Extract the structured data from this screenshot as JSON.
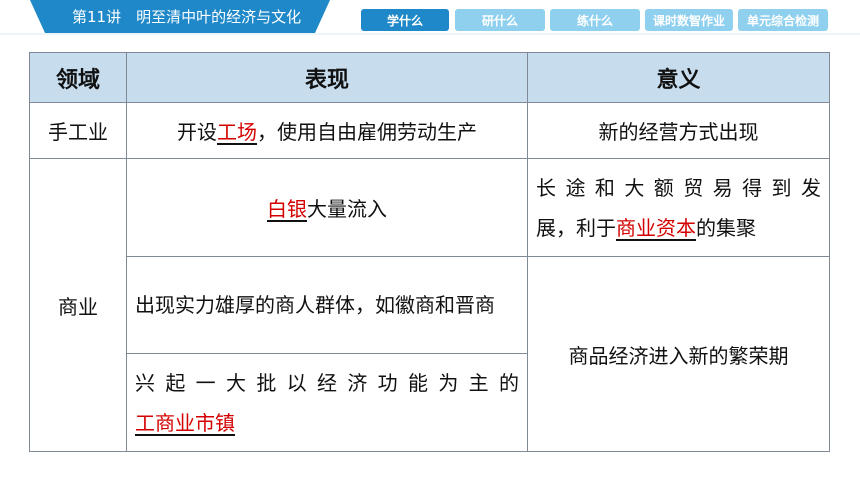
{
  "header": {
    "lesson_title": "第11讲　明至清中叶的经济与文化",
    "tabs": [
      {
        "label": "学什么",
        "active": true
      },
      {
        "label": "研什么",
        "active": false
      },
      {
        "label": "练什么",
        "active": false
      },
      {
        "label": "课时数智作业",
        "active": false
      },
      {
        "label": "单元综合检测",
        "active": false
      }
    ],
    "colors": {
      "accent": "#1e88c9",
      "tab_inactive": "#8fd0ef",
      "table_header": "#c7ddee",
      "highlight": "#d40000"
    }
  },
  "table": {
    "headers": [
      "领域",
      "表现",
      "意义"
    ],
    "rows": {
      "handicraft": {
        "domain": "手工业",
        "perf_prefix": "开设",
        "perf_highlight": "工场",
        "perf_suffix": "，使用自由雇佣劳动生产",
        "meaning": "新的经营方式出现"
      },
      "commerce": {
        "domain": "商业",
        "silver_highlight": "白银",
        "silver_suffix": "大量流入",
        "silver_meaning_line1": "长途和大额贸易得到发",
        "silver_meaning_prefix": "展，利于",
        "silver_meaning_highlight": "商业资本",
        "silver_meaning_suffix": "的集聚",
        "merchants": "出现实力雄厚的商人群体，如徽商和晋商",
        "towns_line1": "兴起一大批以经济功能为主的",
        "towns_highlight": "工商业市镇",
        "merged_meaning": "商品经济进入新的繁荣期"
      }
    }
  }
}
